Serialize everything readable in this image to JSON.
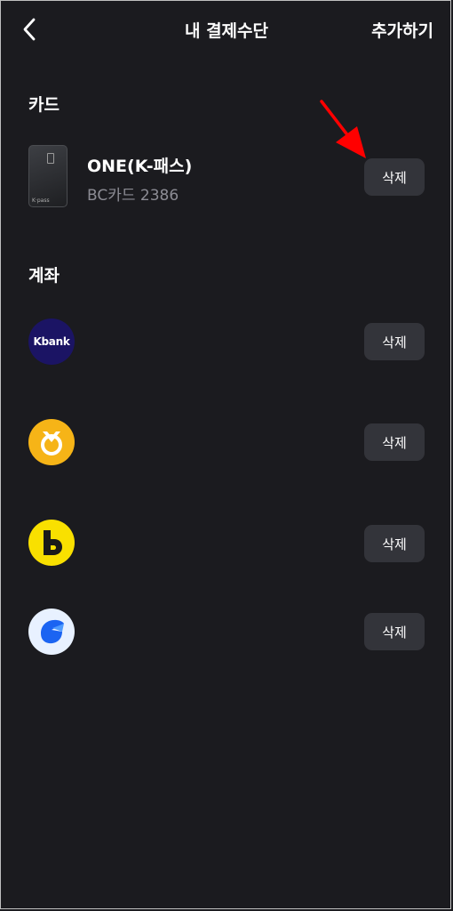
{
  "header": {
    "title": "내 결제수단",
    "add_label": "추가하기"
  },
  "sections": {
    "card_label": "카드",
    "account_label": "계좌"
  },
  "card": {
    "name": "ONE(K-패스)",
    "subtitle": "BC카드 2386",
    "thumb_logo": "K·pass",
    "delete_label": "삭제"
  },
  "accounts": [
    {
      "bank_icon": "kbank-logo-icon",
      "logo_text": "Kbank",
      "delete_label": "삭제"
    },
    {
      "bank_icon": "kb-bank-logo-icon",
      "delete_label": "삭제"
    },
    {
      "bank_icon": "kakaobank-logo-icon",
      "delete_label": "삭제"
    },
    {
      "bank_icon": "toss-logo-icon",
      "delete_label": "삭제"
    }
  ],
  "colors": {
    "background": "#1b1b1f",
    "button_bg": "#33343a",
    "annotation_arrow": "#ff0000"
  }
}
